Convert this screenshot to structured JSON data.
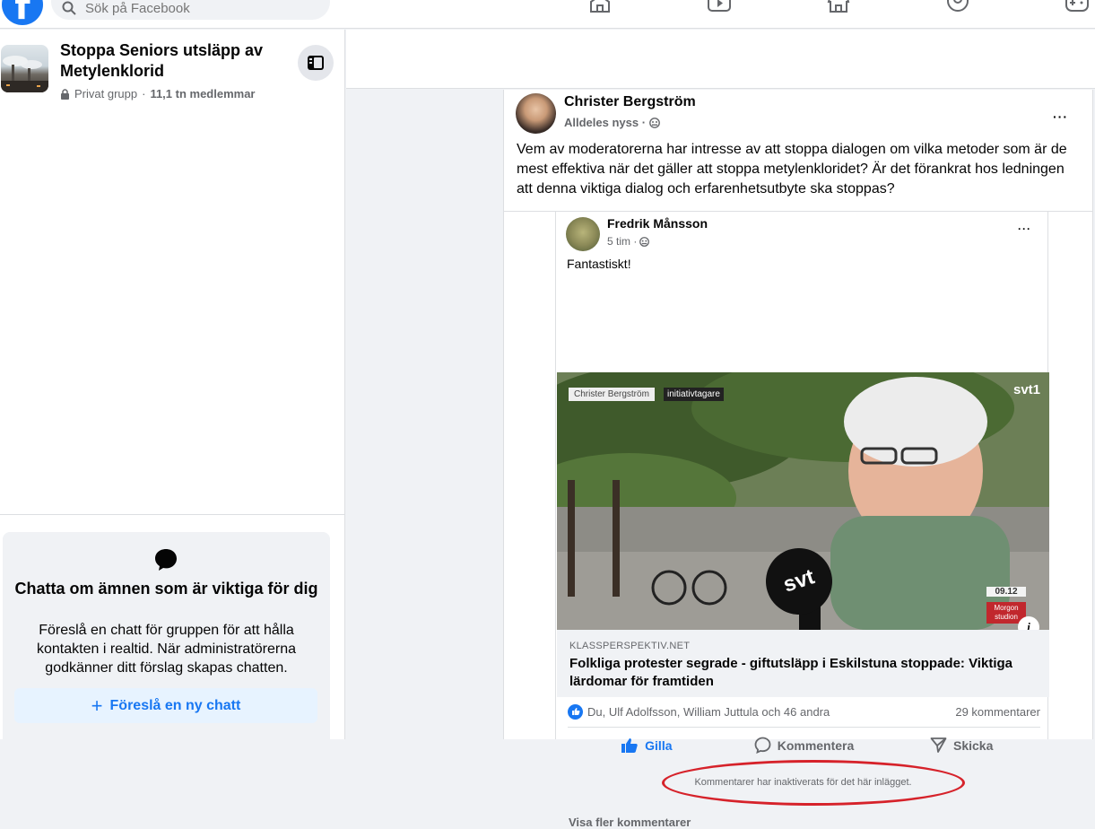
{
  "topbar": {
    "logo": "f",
    "search_placeholder": "Sök på Facebook",
    "nav_icons": [
      "home-icon",
      "video-icon",
      "marketplace-icon",
      "groups-icon",
      "gaming-icon"
    ]
  },
  "group": {
    "title": "Stoppa Seniors utsläpp av Metylenklorid",
    "privacy": "Privat grupp",
    "separator": "·",
    "members": "11,1 tn medlemmar"
  },
  "chat_card": {
    "title": "Chatta om ämnen som är viktiga för dig",
    "description": "Föreslå en chatt för gruppen för att hålla kontakten i realtid. När administratörerna godkänner ditt förslag skapas chatten.",
    "button_label": "Föreslå en ny chatt",
    "button_plus": "+"
  },
  "post": {
    "author": "Christer Bergström",
    "time": "Alldeles nyss ·",
    "text": "Vem av moderatorerna har intresse av att stoppa dialogen om vilka metoder som är de mest effektiva när det gäller att stoppa metylenkloridet? Är det förankrat hos ledningen att denna viktiga dialog och erfarenhetsutbyte ska stoppas?",
    "more": "···"
  },
  "shared_post": {
    "author": "Fredrik Månsson",
    "time": "5 tim ·",
    "text": "Fantastiskt!",
    "more": "···",
    "video": {
      "lower_third_name": "Christer Bergström",
      "lower_third_role": "initiativtagare",
      "channel": "svt1",
      "mic_logo": "svt",
      "clock": "09.12",
      "show": "Morgon studion",
      "info": "i"
    },
    "link": {
      "domain": "KLASSPERSPEKTIV.NET",
      "title": "Folkliga protester segrade - giftutsläpp i Eskilstuna stoppade: Viktiga lärdomar för framtiden"
    },
    "reactions": "Du, Ulf Adolfsson, William Juttula och 46 andra",
    "comment_count": "29 kommentarer",
    "actions": {
      "like": "Gilla",
      "comment": "Kommentera",
      "share": "Skicka"
    },
    "comments_disabled": "Kommentarer har inaktiverats för det här inlägget.",
    "more_comments": "Visa fler kommentarer"
  },
  "colors": {
    "brand": "#1877f2",
    "annotation_ring": "#d6222a",
    "background": "#f0f2f5"
  }
}
